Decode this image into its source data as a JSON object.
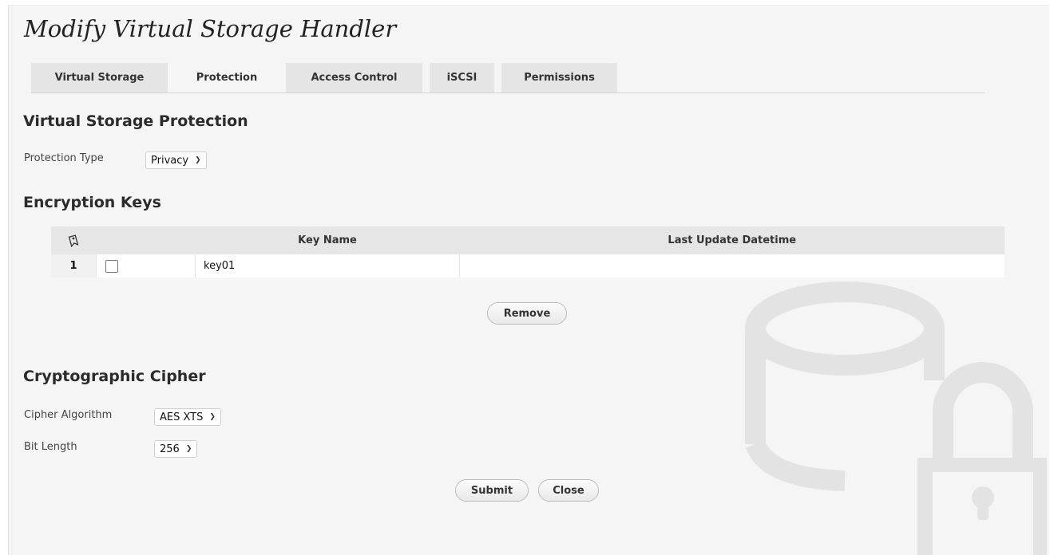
{
  "dialog": {
    "title": "Modify Virtual Storage Handler"
  },
  "tabs": [
    {
      "label": "Virtual Storage",
      "active": false
    },
    {
      "label": "Protection",
      "active": true
    },
    {
      "label": "Access Control",
      "active": false
    },
    {
      "label": "iSCSI",
      "active": false
    },
    {
      "label": "Permissions",
      "active": false
    }
  ],
  "protection": {
    "heading": "Virtual Storage Protection",
    "type_label": "Protection Type",
    "type_value": "Privacy"
  },
  "keys": {
    "heading": "Encryption Keys",
    "header_icon": "tag-icon",
    "columns": [
      "Key Name",
      "Last Update Datetime"
    ],
    "rows": [
      {
        "num": "1",
        "checked": false,
        "name": "key01",
        "updated": ""
      }
    ],
    "remove_label": "Remove"
  },
  "cipher": {
    "heading": "Cryptographic Cipher",
    "algorithm_label": "Cipher Algorithm",
    "algorithm_value": "AES XTS",
    "bit_label": "Bit Length",
    "bit_value": "256"
  },
  "actions": {
    "submit_label": "Submit",
    "close_label": "Close"
  },
  "watermark_icon": "locked-storage-icon",
  "colors": {
    "panel_bg": "#f5f5f5",
    "tab_bg": "#e5e5e5",
    "header_bg": "#e6e6e6",
    "watermark": "#e4e4e4"
  }
}
